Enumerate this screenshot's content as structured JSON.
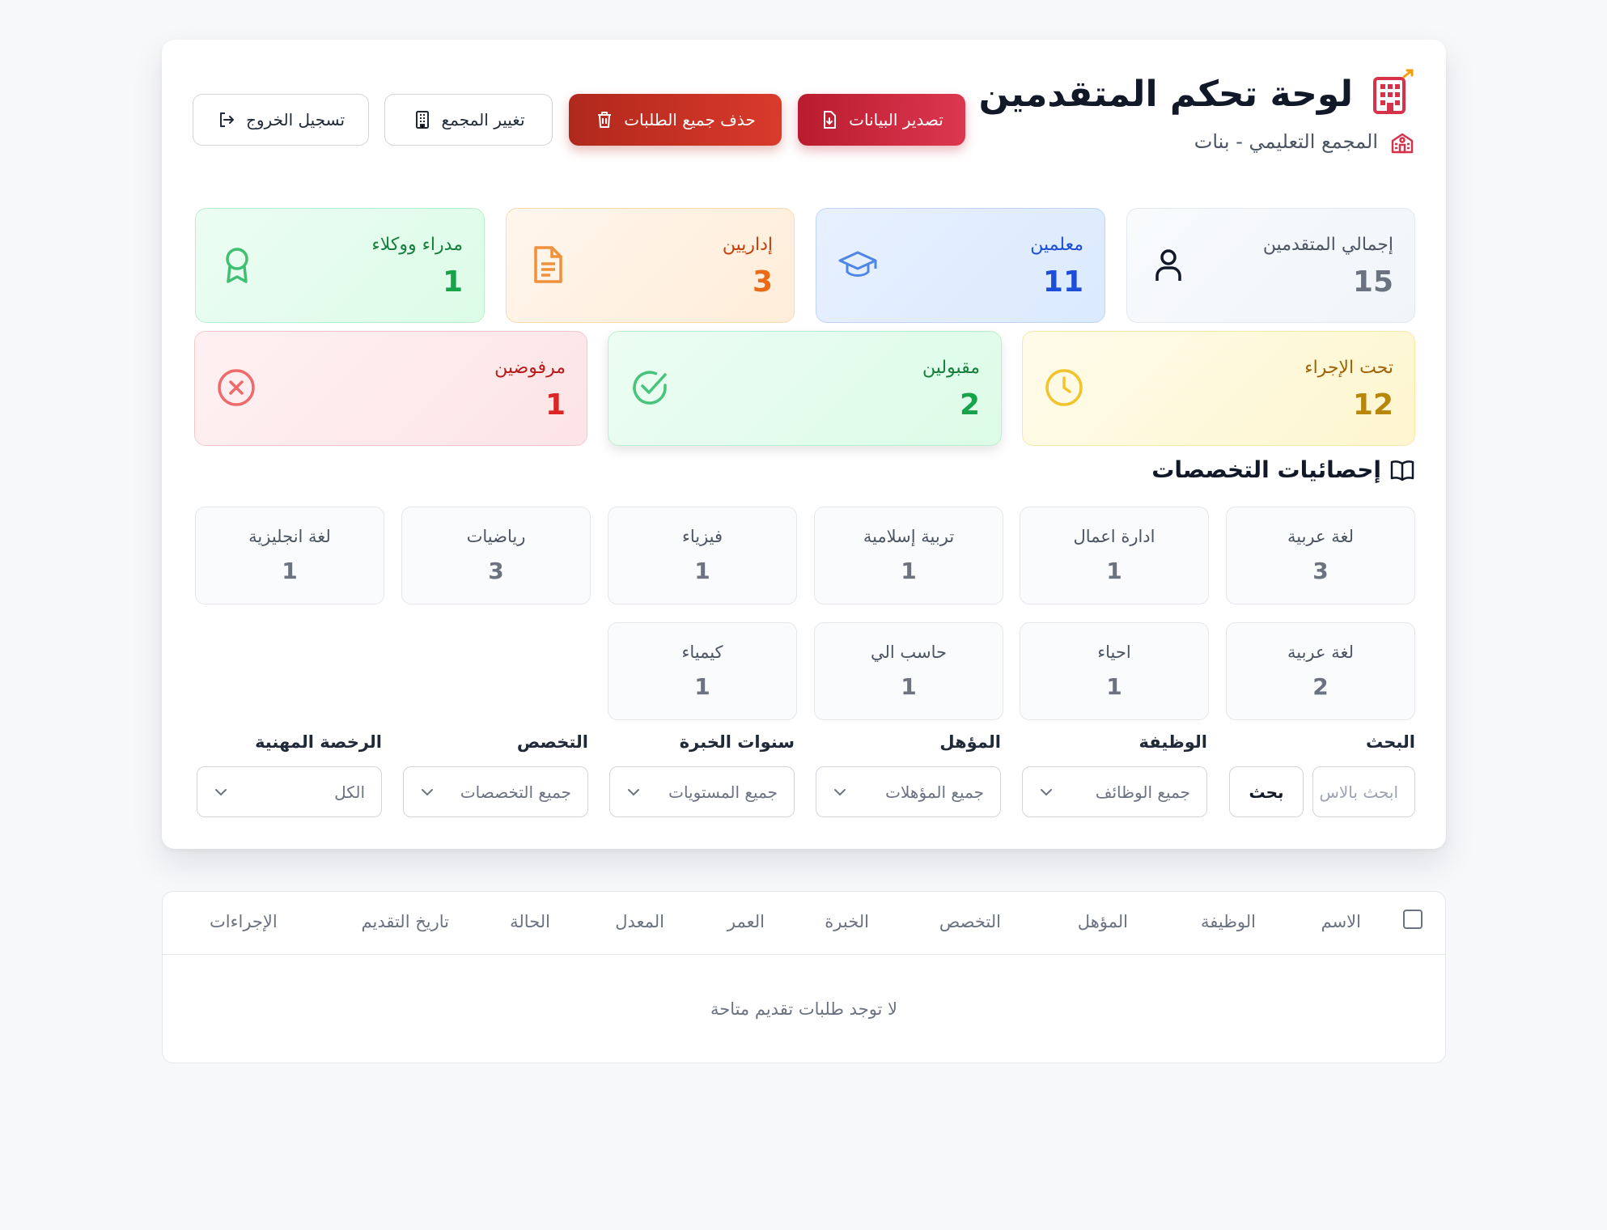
{
  "header": {
    "title": "لوحة تحكم المتقدمين",
    "subtitle": "المجمع التعليمي - بنات",
    "buttons": {
      "export": "تصدير البيانات",
      "delete_all": "حذف جميع الطلبات",
      "change_complex": "تغيير المجمع",
      "logout": "تسجيل الخروج"
    }
  },
  "stats": {
    "total": {
      "label": "إجمالي المتقدمين",
      "value": "15"
    },
    "teachers": {
      "label": "معلمين",
      "value": "11"
    },
    "admins": {
      "label": "إداريين",
      "value": "3"
    },
    "managers": {
      "label": "مدراء ووكلاء",
      "value": "1"
    },
    "pending": {
      "label": "تحت الإجراء",
      "value": "12"
    },
    "accepted": {
      "label": "مقبولين",
      "value": "2"
    },
    "rejected": {
      "label": "مرفوضين",
      "value": "1"
    }
  },
  "specializations": {
    "title": "إحصائيات التخصصات",
    "items": [
      {
        "name": "لغة عربية",
        "count": "3"
      },
      {
        "name": "ادارة اعمال",
        "count": "1"
      },
      {
        "name": "تربية إسلامية",
        "count": "1"
      },
      {
        "name": "فيزياء",
        "count": "1"
      },
      {
        "name": "رياضيات",
        "count": "3"
      },
      {
        "name": "لغة انجليزية",
        "count": "1"
      },
      {
        "name": "لغة عربية",
        "count": "2"
      },
      {
        "name": "احياء",
        "count": "1"
      },
      {
        "name": "حاسب الي",
        "count": "1"
      },
      {
        "name": "كيمياء",
        "count": "1"
      }
    ]
  },
  "filters": {
    "search": {
      "label": "البحث",
      "placeholder": "ابحث بالاس",
      "button": "بحث"
    },
    "job": {
      "label": "الوظيفة",
      "value": "جميع الوظائف"
    },
    "qualification": {
      "label": "المؤهل",
      "value": "جميع المؤهلات"
    },
    "experience": {
      "label": "سنوات الخبرة",
      "value": "جميع المستويات"
    },
    "specialization": {
      "label": "التخصص",
      "value": "جميع التخصصات"
    },
    "license": {
      "label": "الرخصة المهنية",
      "value": "الكل"
    }
  },
  "table": {
    "columns": [
      "الاسم",
      "الوظيفة",
      "المؤهل",
      "التخصص",
      "الخبرة",
      "العمر",
      "المعدل",
      "الحالة",
      "تاريخ التقديم",
      "الإجراءات"
    ],
    "empty_message": "لا توجد طلبات تقديم متاحة"
  },
  "colors": {
    "primary_red": "#c62a3e",
    "teacher_blue": "#1d4ed8",
    "admin_orange": "#ea6a17",
    "manager_green": "#16a34a",
    "pending_gold": "#b8860b",
    "rejected_red": "#dc2626"
  }
}
